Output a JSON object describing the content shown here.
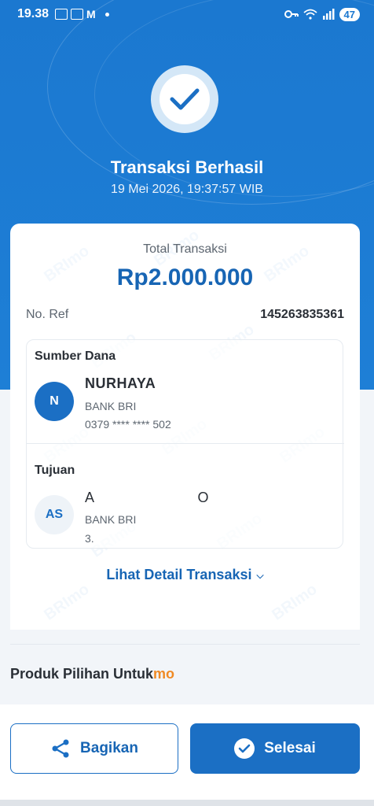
{
  "status_bar": {
    "time": "19.38",
    "notif_icons": [
      "bri-mo-icon",
      "bri-mo-icon",
      "gmail-icon",
      "dot-icon"
    ],
    "battery": "47"
  },
  "header": {
    "title": "Transaksi Berhasil",
    "datetime": "19 Mei 2026, 19:37:57 WIB"
  },
  "receipt": {
    "total_label": "Total Transaksi",
    "total_amount": "Rp2.000.000",
    "ref_label": "No. Ref",
    "ref_value": "145263835361",
    "source": {
      "title": "Sumber Dana",
      "initials": "N",
      "name": "NURHAYA",
      "bank": "BANK BRI",
      "account": "0379 **** **** 502"
    },
    "destination": {
      "title": "Tujuan",
      "initials": "AS",
      "name": "A                        O",
      "bank": "BANK BRI",
      "account": "3."
    },
    "detail_link": "Lihat Detail Transaksi"
  },
  "products": {
    "label": "Produk Pilihan Untuk",
    "brand": "mo"
  },
  "actions": {
    "share_label": "Bagikan",
    "done_label": "Selesai"
  },
  "colors": {
    "primary": "#1b78d0",
    "accent": "#1765b4",
    "orange": "#f08a24"
  }
}
